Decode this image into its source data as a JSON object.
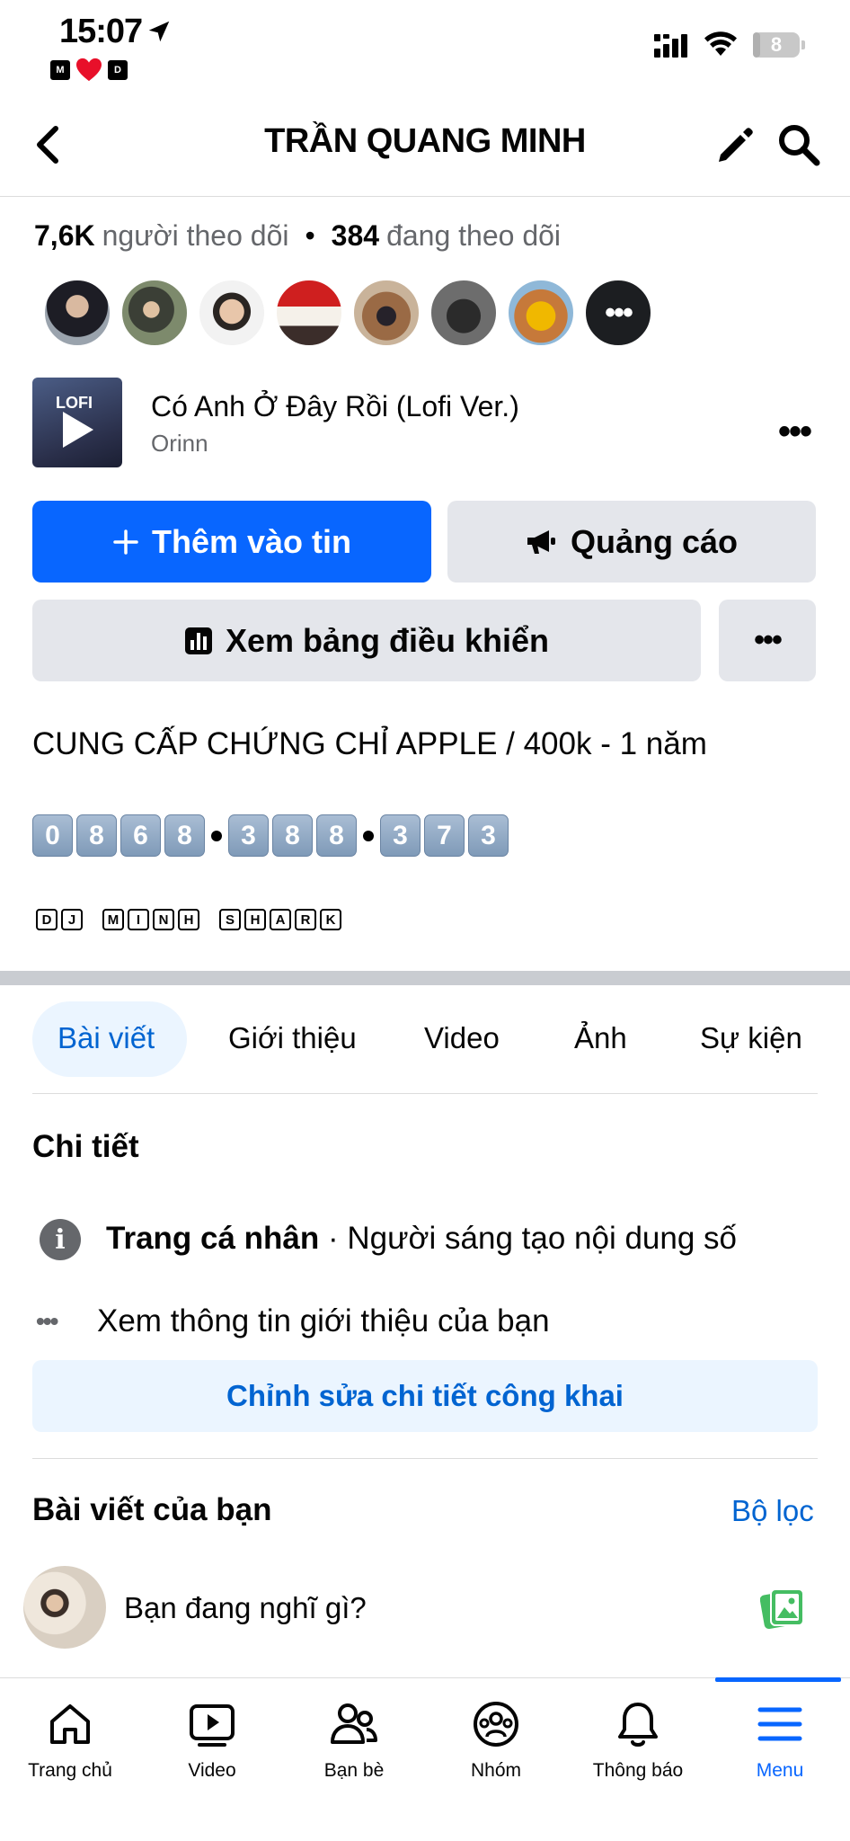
{
  "status_bar": {
    "time": "15:07",
    "badges": [
      "M",
      "D"
    ],
    "battery": "8",
    "battery_level_percent": 8
  },
  "header": {
    "title": "TRẦN QUANG MINH"
  },
  "followers": {
    "followers_count": "7,6K",
    "followers_label": "người theo dõi",
    "separator": "•",
    "following_count": "384",
    "following_label": "đang theo dõi",
    "more_label": "•••"
  },
  "music": {
    "thumb_text": "LOFI",
    "song": "Có Anh Ở Đây Rồi (Lofi Ver.)",
    "artist": "Orinn",
    "more": "•••"
  },
  "actions": {
    "add_story": "Thêm vào tin",
    "ads": "Quảng cáo",
    "dashboard": "Xem bảng điều khiển",
    "more": "•••"
  },
  "bio": {
    "line1": "CUNG CẤP CHỨNG CHỈ APPLE / 400k - 1 năm",
    "phone_groups": [
      [
        "0",
        "8",
        "6",
        "8"
      ],
      [
        "3",
        "8",
        "8"
      ],
      [
        "3",
        "7",
        "3"
      ]
    ],
    "signature_words": [
      [
        "D",
        "J"
      ],
      [
        "M",
        "I",
        "N",
        "H"
      ],
      [
        "S",
        "H",
        "A",
        "R",
        "K"
      ]
    ]
  },
  "tabs": [
    {
      "label": "Bài viết",
      "active": true
    },
    {
      "label": "Giới thiệu",
      "active": false
    },
    {
      "label": "Video",
      "active": false
    },
    {
      "label": "Ảnh",
      "active": false
    },
    {
      "label": "Sự kiện",
      "active": false
    }
  ],
  "details": {
    "title": "Chi tiết",
    "page_type_label": "Trang cá nhân",
    "page_type_value": " · Người sáng tạo nội dung số",
    "see_intro": "Xem thông tin giới thiệu của bạn",
    "edit_public": "Chỉnh sửa chi tiết công khai"
  },
  "posts": {
    "title": "Bài viết của bạn",
    "filter": "Bộ lọc",
    "composer_placeholder": "Bạn đang nghĩ gì?"
  },
  "bottom_nav": [
    {
      "label": "Trang chủ",
      "icon": "home-icon",
      "active": false
    },
    {
      "label": "Video",
      "icon": "video-icon",
      "active": false
    },
    {
      "label": "Bạn bè",
      "icon": "friends-icon",
      "active": false
    },
    {
      "label": "Nhóm",
      "icon": "groups-icon",
      "active": false
    },
    {
      "label": "Thông báo",
      "icon": "bell-icon",
      "active": false
    },
    {
      "label": "Menu",
      "icon": "menu-icon",
      "active": true
    }
  ],
  "colors": {
    "primary": "#0866ff",
    "secondary_button": "#e4e6eb",
    "link": "#0064d1",
    "muted_text": "#65676b",
    "highlight_bg": "#ebf5ff"
  }
}
